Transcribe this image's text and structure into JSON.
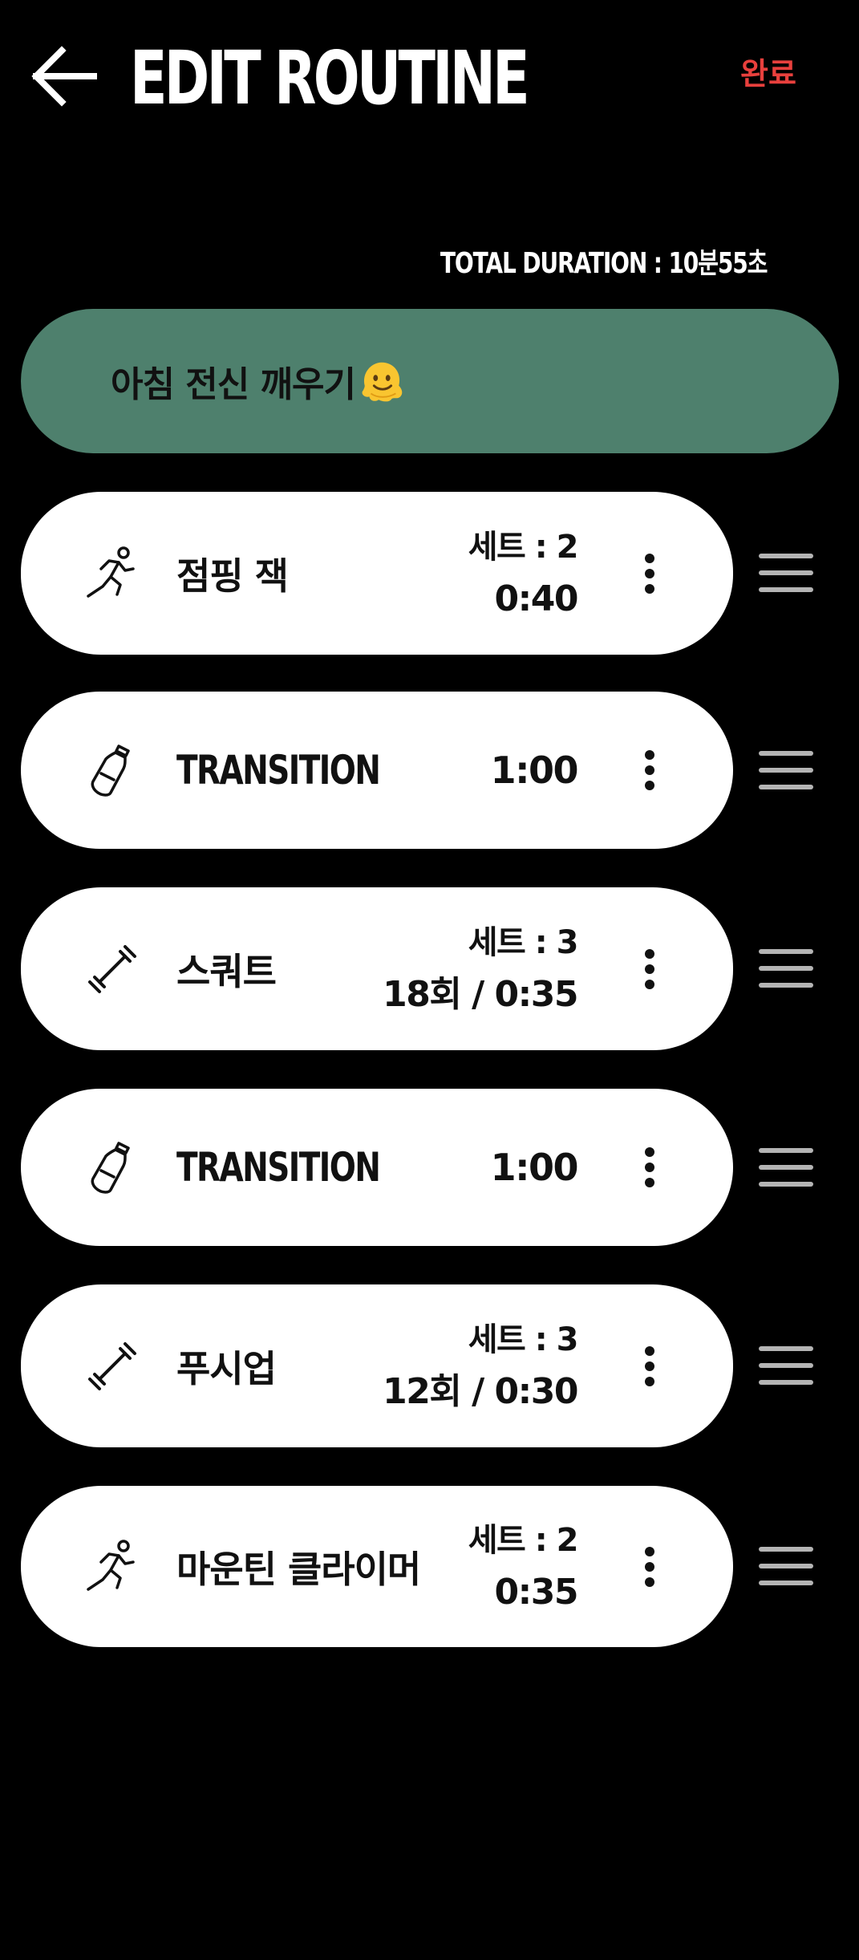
{
  "header": {
    "title": "EDIT ROUTINE",
    "done_label": "완료",
    "accent_color": "#e8403d"
  },
  "total_duration": "TOTAL DURATION : 10분55초",
  "routine": {
    "name": "아침 전신 깨우기",
    "name_color": "#4e806d",
    "emoji_icon": "melting-face-emoji"
  },
  "exercises": [
    {
      "icon": "running-person-icon",
      "name": "점핑 잭",
      "sets": "세트 : 2",
      "detail": "0:40"
    },
    {
      "icon": "water-bottle-icon",
      "name": "TRANSITION",
      "detail": "1:00"
    },
    {
      "icon": "dumbbell-icon",
      "name": "스쿼트",
      "sets": "세트 : 3",
      "detail": "18회 / 0:35"
    },
    {
      "icon": "water-bottle-icon",
      "name": "TRANSITION",
      "detail": "1:00"
    },
    {
      "icon": "dumbbell-icon",
      "name": "푸시업",
      "sets": "세트 : 3",
      "detail": "12회 / 0:30"
    },
    {
      "icon": "running-person-icon",
      "name": "마운틴 클라이머",
      "sets": "세트 : 2",
      "detail": "0:35"
    }
  ]
}
